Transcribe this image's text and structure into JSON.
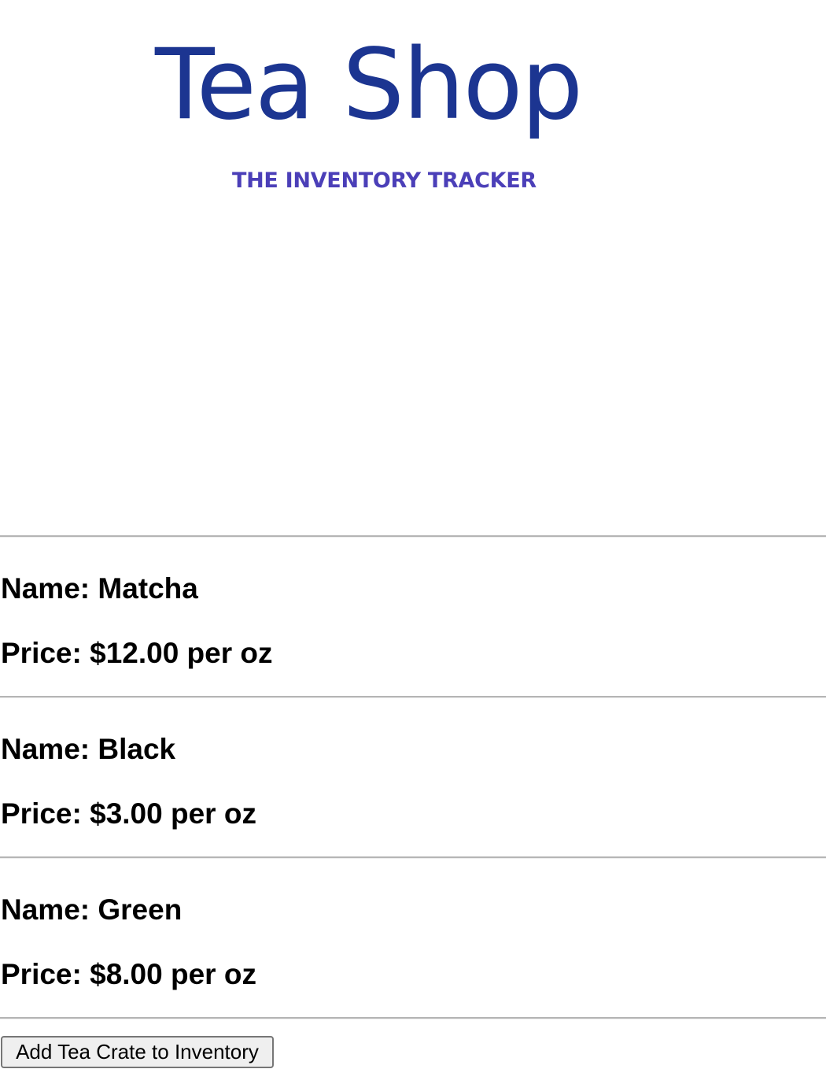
{
  "logo": {
    "title": "Tea Shop",
    "subtitle": "THE INVENTORY TRACKER",
    "colors": {
      "title": "#1c3591",
      "subtitle": "#4b3fb8"
    }
  },
  "teas": [
    {
      "name_label": "Name: Matcha",
      "price_label": "Price: $12.00 per oz"
    },
    {
      "name_label": "Name: Black",
      "price_label": "Price: $3.00 per oz"
    },
    {
      "name_label": "Name: Green",
      "price_label": "Price: $8.00 per oz"
    }
  ],
  "actions": {
    "add_button_label": "Add Tea Crate to Inventory"
  }
}
